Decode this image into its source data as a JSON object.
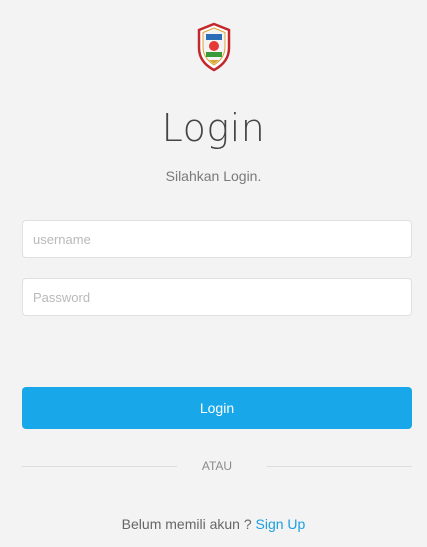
{
  "header": {
    "title": "Login",
    "subtitle": "Silahkan Login."
  },
  "form": {
    "username_placeholder": "username",
    "password_placeholder": "Password",
    "login_label": "Login"
  },
  "divider": {
    "label": "ATAU"
  },
  "signup": {
    "prompt": "Belum memili akun ? ",
    "link_label": "Sign Up"
  },
  "colors": {
    "background": "#f3f3f3",
    "accent": "#18a8e9",
    "link": "#1aa0e0"
  },
  "icons": {
    "logo": "shield-emblem-icon"
  }
}
